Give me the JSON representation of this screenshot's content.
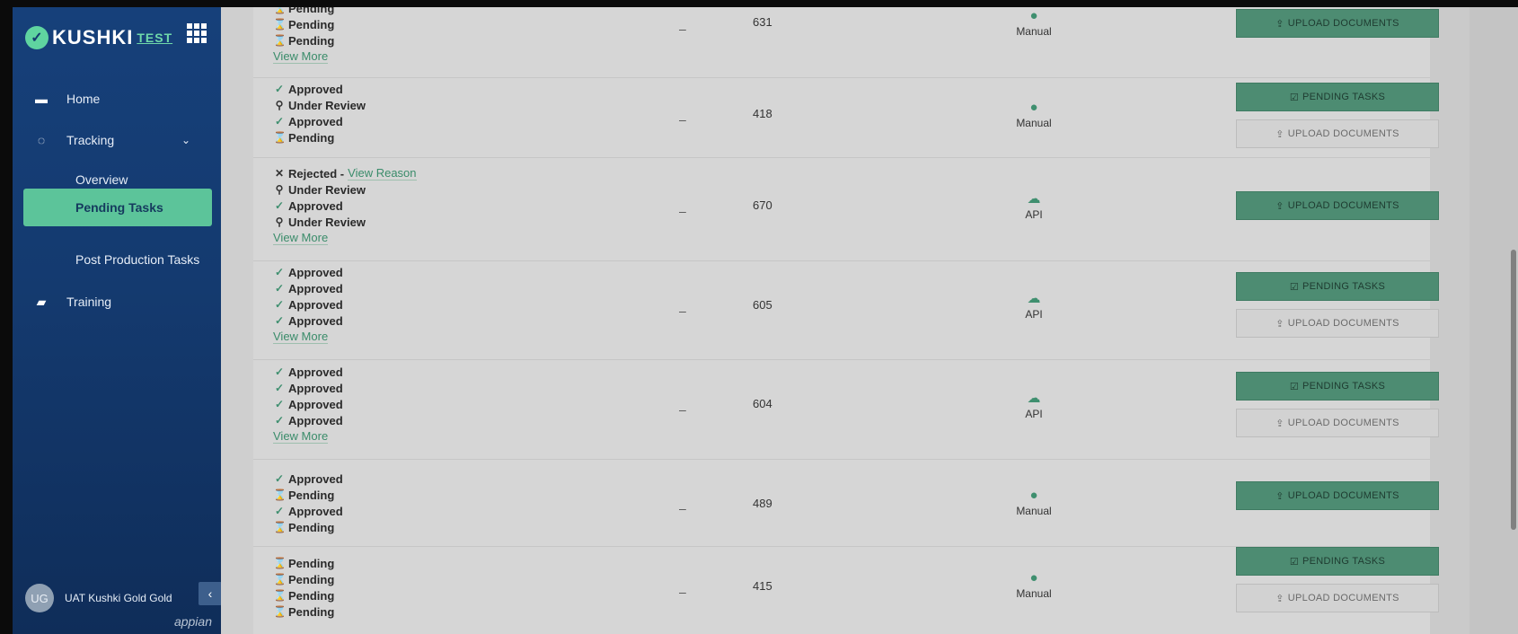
{
  "app": {
    "brand": "KUSHKI",
    "env": "TEST",
    "footer": "appian"
  },
  "colors": {
    "sidebar": "#143a6f",
    "accent": "#5cc49a",
    "primary_button": "#4d8c72"
  },
  "nav": {
    "home": "Home",
    "tracking": "Tracking",
    "overview": "Overview",
    "pending_tasks": "Pending Tasks",
    "post_production": "Post Production Tasks",
    "training": "Training"
  },
  "user": {
    "initials": "UG",
    "name": "UAT Kushki Gold Gold"
  },
  "labels": {
    "upload": "UPLOAD DOCUMENTS",
    "pending": "PENDING TASKS",
    "view_more": "View More",
    "view_reason": "View Reason"
  },
  "rows": [
    {
      "statuses": [
        "Pending",
        "Pending",
        "Pending"
      ],
      "dash": "–",
      "id": "631",
      "method": "Manual"
    },
    {
      "statuses": [
        "Approved",
        "Under Review",
        "Approved",
        "Pending"
      ],
      "dash": "–",
      "id": "418",
      "method": "Manual"
    },
    {
      "statuses": [
        "Rejected -",
        "Under Review",
        "Approved",
        "Under Review"
      ],
      "dash": "–",
      "id": "670",
      "method": "API"
    },
    {
      "statuses": [
        "Approved",
        "Approved",
        "Approved",
        "Approved"
      ],
      "dash": "–",
      "id": "605",
      "method": "API"
    },
    {
      "statuses": [
        "Approved",
        "Approved",
        "Approved",
        "Approved"
      ],
      "dash": "–",
      "id": "604",
      "method": "API"
    },
    {
      "statuses": [
        "Approved",
        "Pending",
        "Approved",
        "Pending"
      ],
      "dash": "–",
      "id": "489",
      "method": "Manual"
    },
    {
      "statuses": [
        "Pending",
        "Pending",
        "Pending",
        "Pending"
      ],
      "dash": "–",
      "id": "415",
      "method": "Manual"
    }
  ]
}
